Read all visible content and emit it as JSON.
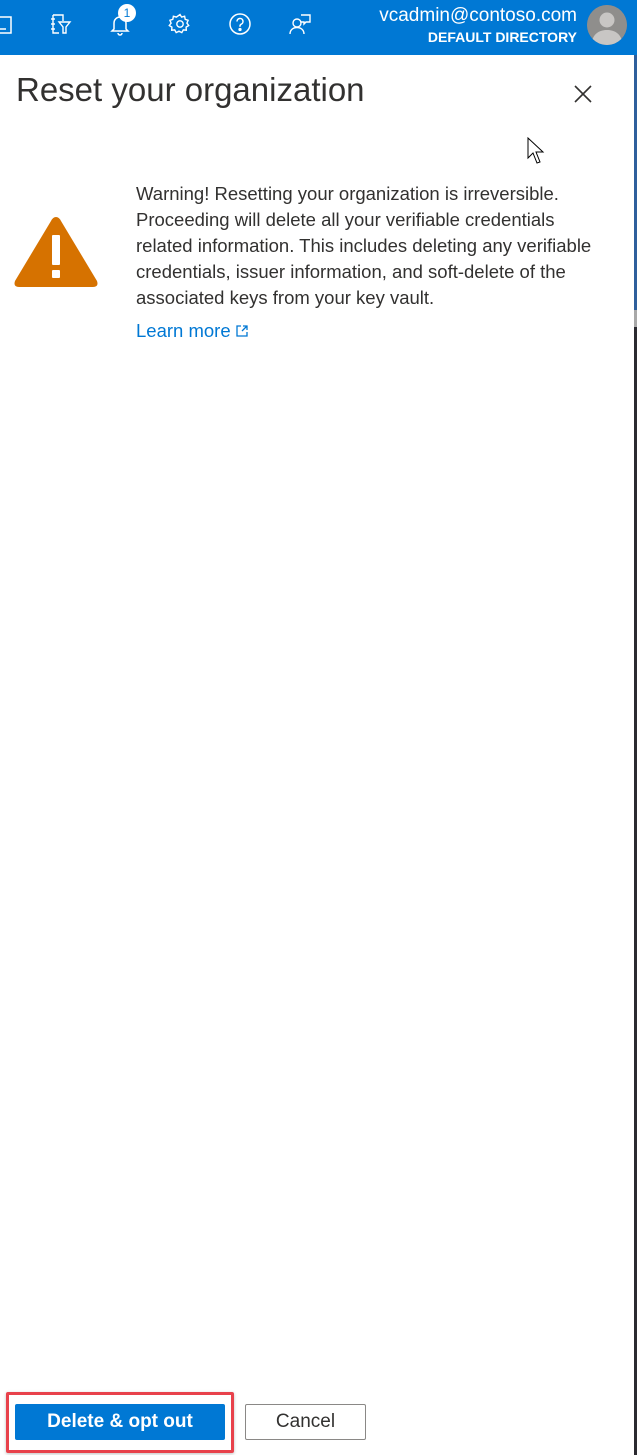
{
  "topbar": {
    "icons": [
      {
        "name": "portal-menu-icon"
      },
      {
        "name": "directory-filter-icon"
      },
      {
        "name": "notifications-icon",
        "badge": "1"
      },
      {
        "name": "settings-icon"
      },
      {
        "name": "help-icon"
      },
      {
        "name": "feedback-icon"
      }
    ],
    "account": {
      "email": "vcadmin@contoso.com",
      "directory": "DEFAULT DIRECTORY"
    },
    "colors": {
      "background": "#0078d4"
    }
  },
  "panel": {
    "title": "Reset your organization",
    "close_label": "Close",
    "warning": {
      "icon": "warning-triangle-icon",
      "color": "#d67200",
      "text": "Warning! Resetting your organization is irreversible. Proceeding will delete all your verifiable credentials related information. This includes deleting any verifiable credentials, issuer information, and soft-delete of the associated keys from your key vault."
    },
    "learn_more": {
      "label": "Learn more",
      "icon": "external-link-icon"
    }
  },
  "footer": {
    "primary_button": "Delete & opt out",
    "secondary_button": "Cancel",
    "highlight_color": "#e8414b"
  }
}
